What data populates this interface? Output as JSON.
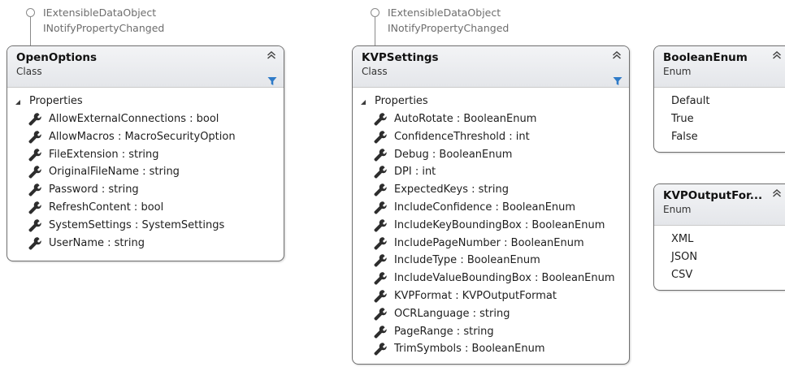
{
  "interfaces": [
    "IExtensibleDataObject",
    "INotifyPropertyChanged"
  ],
  "open_options": {
    "name": "OpenOptions",
    "kind": "Class",
    "section": "Properties",
    "properties": [
      "AllowExternalConnections : bool",
      "AllowMacros : MacroSecurityOption",
      "FileExtension : string",
      "OriginalFileName : string",
      "Password : string",
      "RefreshContent : bool",
      "SystemSettings : SystemSettings",
      "UserName : string"
    ]
  },
  "kvp_settings": {
    "name": "KVPSettings",
    "kind": "Class",
    "section": "Properties",
    "properties": [
      "AutoRotate : BooleanEnum",
      "ConfidenceThreshold : int",
      "Debug : BooleanEnum",
      "DPI : int",
      "ExpectedKeys : string",
      "IncludeConfidence : BooleanEnum",
      "IncludeKeyBoundingBox : BooleanEnum",
      "IncludePageNumber : BooleanEnum",
      "IncludeType : BooleanEnum",
      "IncludeValueBoundingBox : BooleanEnum",
      "KVPFormat : KVPOutputFormat",
      "OCRLanguage : string",
      "PageRange : string",
      "TrimSymbols : BooleanEnum"
    ]
  },
  "boolean_enum": {
    "name": "BooleanEnum",
    "kind": "Enum",
    "values": [
      "Default",
      "True",
      "False"
    ]
  },
  "kvp_output_format": {
    "name": "KVPOutputFor...",
    "kind": "Enum",
    "values": [
      "XML",
      "JSON",
      "CSV"
    ]
  },
  "icons": {
    "interface": "lollipop-interface-icon",
    "collapse": "double-chevron-up-icon",
    "filter": "filter-icon",
    "property": "wrench-icon",
    "section_toggle": "triangle-expanded-icon"
  },
  "colors": {
    "header_top": "#f3f4f6",
    "header_bottom": "#e4e6ea",
    "border": "#6f6f6f",
    "filter": "#2f7bc8",
    "interface_text": "#6d6d6d"
  }
}
